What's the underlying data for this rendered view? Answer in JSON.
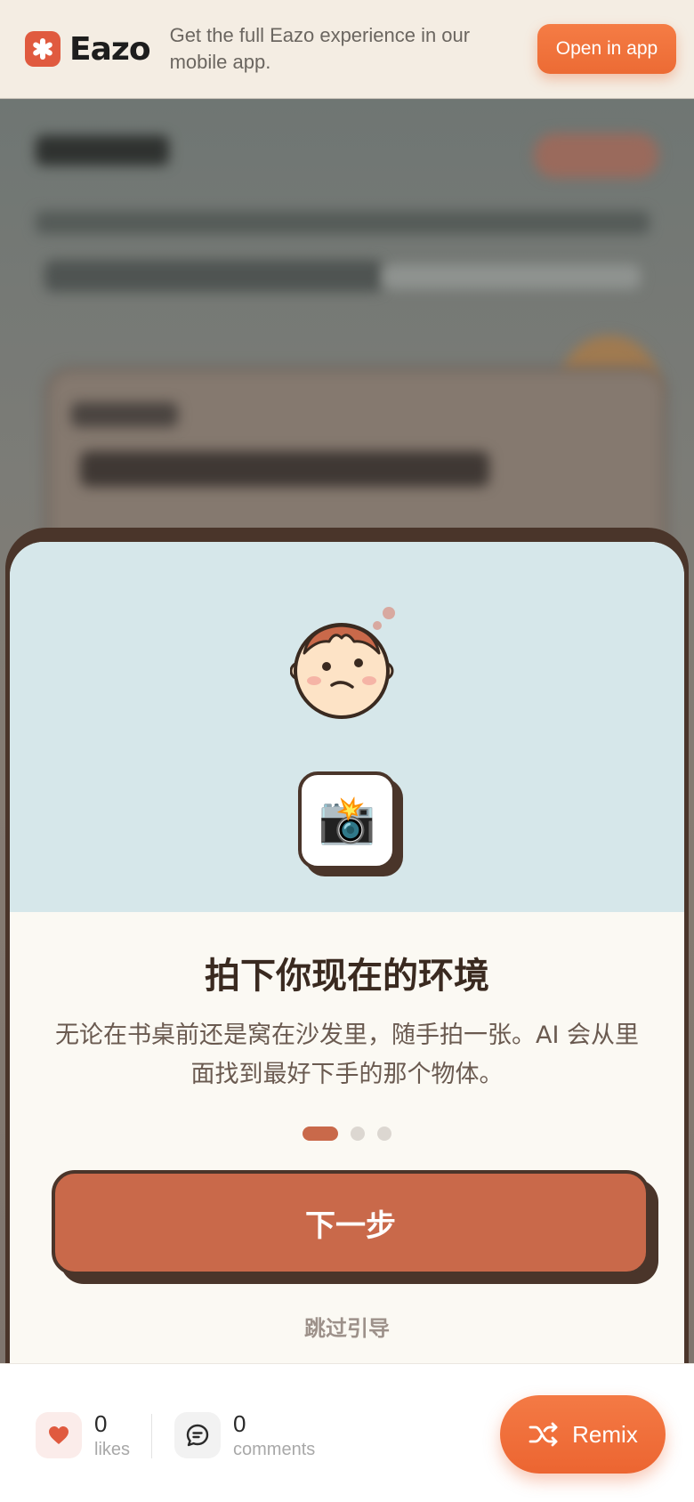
{
  "banner": {
    "brand": "Eazo",
    "message": "Get the full Eazo experience in our mobile app.",
    "open_button": "Open in app"
  },
  "onboarding": {
    "title": "拍下你现在的环境",
    "description": "无论在书桌前还是窝在沙发里，随手拍一张。AI 会从里面找到最好下手的那个物体。",
    "camera_emoji": "📸",
    "step_current": 1,
    "step_total": 3,
    "next_button": "下一步",
    "skip_link": "跳过引导"
  },
  "bottom_bar": {
    "likes_count": "0",
    "likes_label": "likes",
    "comments_count": "0",
    "comments_label": "comments",
    "remix_button": "Remix"
  },
  "colors": {
    "brand_orange": "#ec6b34",
    "card_accent": "#c9694a",
    "card_outline": "#4a352a",
    "illustration_bg": "#d6e7ea"
  }
}
